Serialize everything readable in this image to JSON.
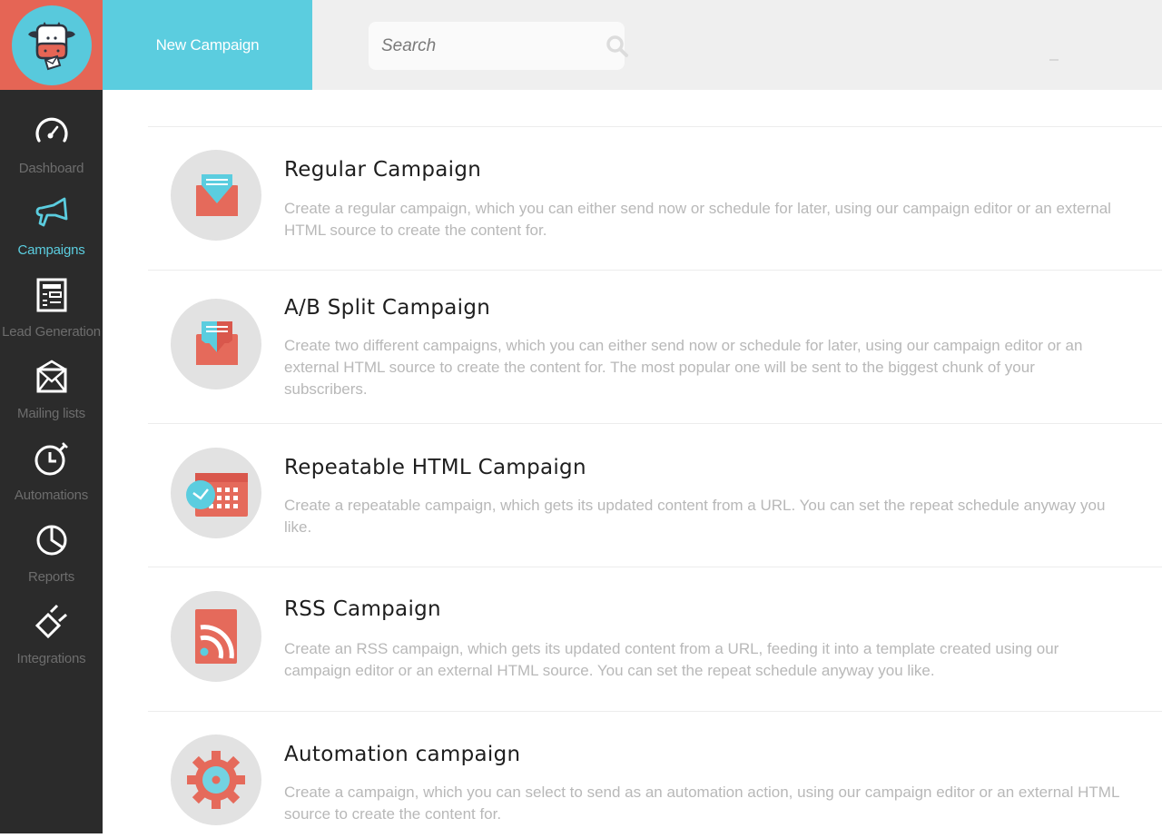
{
  "header": {
    "logo_alt": "cow mascot logo",
    "new_campaign_label": "New Campaign",
    "search_placeholder": "Search",
    "search_value": ""
  },
  "sidebar": {
    "items": [
      {
        "label": "Dashboard",
        "icon": "gauge-icon",
        "active": false
      },
      {
        "label": "Campaigns",
        "icon": "megaphone-icon",
        "active": true
      },
      {
        "label": "Lead Generation",
        "icon": "form-icon",
        "active": false
      },
      {
        "label": "Mailing lists",
        "icon": "envelope-icon",
        "active": false
      },
      {
        "label": "Automations",
        "icon": "stopwatch-icon",
        "active": false
      },
      {
        "label": "Reports",
        "icon": "pie-chart-icon",
        "active": false
      },
      {
        "label": "Integrations",
        "icon": "plug-icon",
        "active": false
      }
    ]
  },
  "colors": {
    "brand_red": "#e56555",
    "brand_cyan": "#5bcddf",
    "sidebar_bg": "#2b2b2b",
    "topbar_bg": "#efefef"
  },
  "campaigns": [
    {
      "title": "Regular Campaign",
      "icon": "envelope-open-icon",
      "description": "Create a regular campaign, which you can either send now or schedule for later, using our campaign editor or an external HTML source to create the content for."
    },
    {
      "title": "A/B Split Campaign",
      "icon": "split-envelope-icon",
      "description": "Create two different campaigns, which you can either send now or schedule for later, using our campaign editor or an external HTML source to create the content for. The most popular one will be sent to the biggest chunk of your subscribers."
    },
    {
      "title": "Repeatable HTML Campaign",
      "icon": "calendar-clock-icon",
      "description": "Create a repeatable campaign, which gets its updated content from a URL. You can set the repeat schedule anyway you like."
    },
    {
      "title": "RSS Campaign",
      "icon": "rss-icon",
      "description": "Create an RSS campaign, which gets its updated content from a URL, feeding it into a template created using our campaign editor or an external HTML source. You can set the repeat schedule anyway you like."
    },
    {
      "title": "Automation campaign",
      "icon": "gear-icon",
      "description": "Create a campaign, which you can select to send as an automation action, using our campaign editor or an external HTML source to create the content for."
    }
  ]
}
